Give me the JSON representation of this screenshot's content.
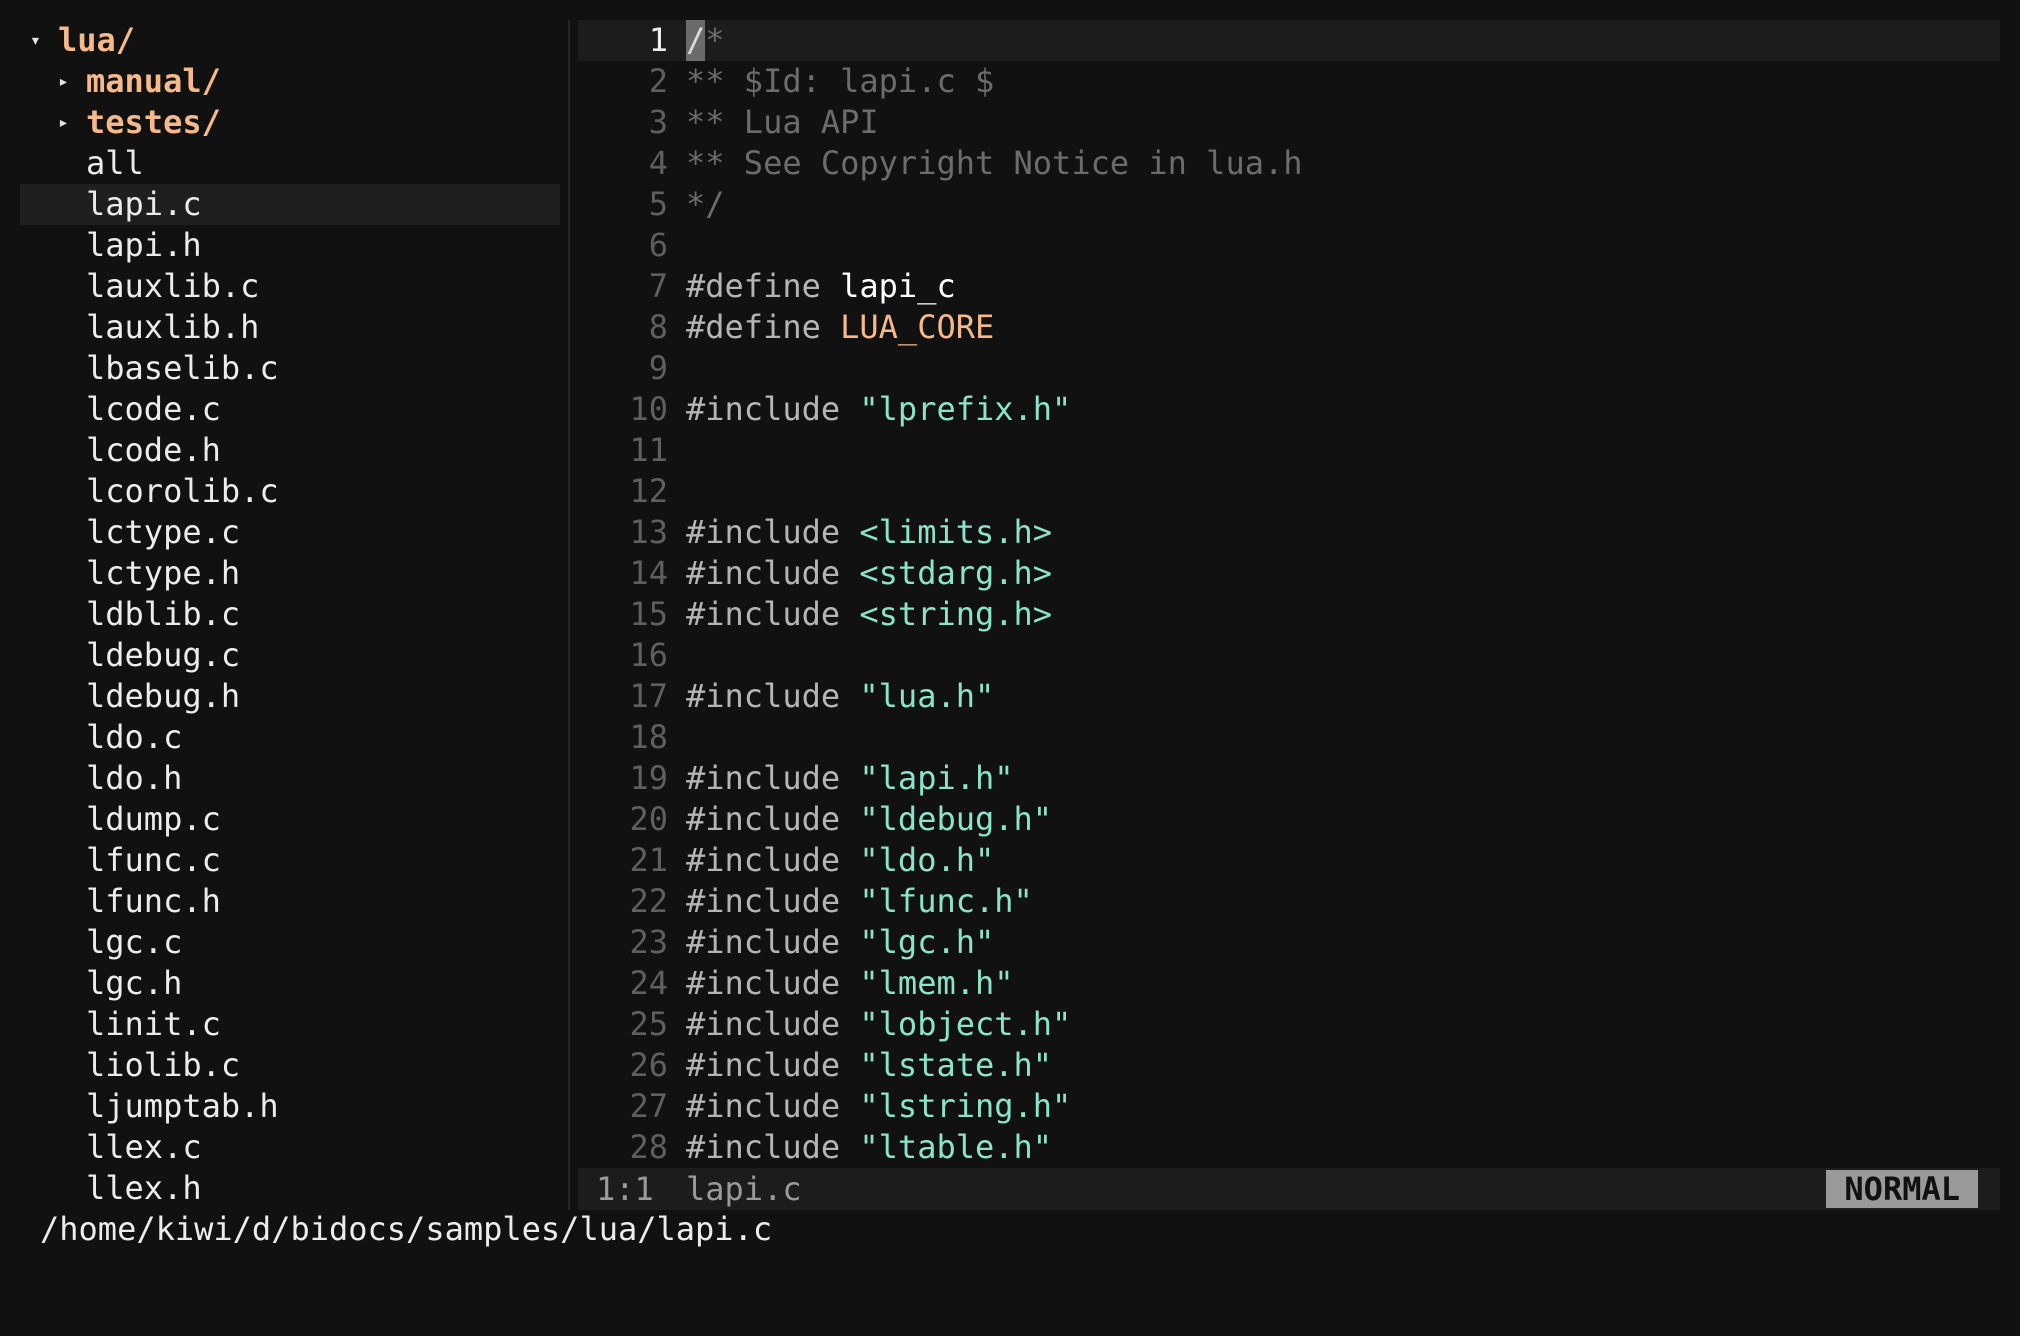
{
  "file_tree": [
    {
      "type": "dir",
      "name": "lua/",
      "expanded": true,
      "depth": 0
    },
    {
      "type": "dir",
      "name": "manual/",
      "expanded": false,
      "depth": 1
    },
    {
      "type": "dir",
      "name": "testes/",
      "expanded": false,
      "depth": 1
    },
    {
      "type": "file",
      "name": "all",
      "depth": 1
    },
    {
      "type": "file",
      "name": "lapi.c",
      "depth": 1,
      "selected": true
    },
    {
      "type": "file",
      "name": "lapi.h",
      "depth": 1
    },
    {
      "type": "file",
      "name": "lauxlib.c",
      "depth": 1
    },
    {
      "type": "file",
      "name": "lauxlib.h",
      "depth": 1
    },
    {
      "type": "file",
      "name": "lbaselib.c",
      "depth": 1
    },
    {
      "type": "file",
      "name": "lcode.c",
      "depth": 1
    },
    {
      "type": "file",
      "name": "lcode.h",
      "depth": 1
    },
    {
      "type": "file",
      "name": "lcorolib.c",
      "depth": 1
    },
    {
      "type": "file",
      "name": "lctype.c",
      "depth": 1
    },
    {
      "type": "file",
      "name": "lctype.h",
      "depth": 1
    },
    {
      "type": "file",
      "name": "ldblib.c",
      "depth": 1
    },
    {
      "type": "file",
      "name": "ldebug.c",
      "depth": 1
    },
    {
      "type": "file",
      "name": "ldebug.h",
      "depth": 1
    },
    {
      "type": "file",
      "name": "ldo.c",
      "depth": 1
    },
    {
      "type": "file",
      "name": "ldo.h",
      "depth": 1
    },
    {
      "type": "file",
      "name": "ldump.c",
      "depth": 1
    },
    {
      "type": "file",
      "name": "lfunc.c",
      "depth": 1
    },
    {
      "type": "file",
      "name": "lfunc.h",
      "depth": 1
    },
    {
      "type": "file",
      "name": "lgc.c",
      "depth": 1
    },
    {
      "type": "file",
      "name": "lgc.h",
      "depth": 1
    },
    {
      "type": "file",
      "name": "linit.c",
      "depth": 1
    },
    {
      "type": "file",
      "name": "liolib.c",
      "depth": 1
    },
    {
      "type": "file",
      "name": "ljumptab.h",
      "depth": 1
    },
    {
      "type": "file",
      "name": "llex.c",
      "depth": 1
    },
    {
      "type": "file",
      "name": "llex.h",
      "depth": 1
    }
  ],
  "editor": {
    "current_line": 1,
    "lines": [
      {
        "n": 1,
        "tokens": [
          {
            "t": "cursor",
            "v": "/"
          },
          {
            "t": "comment",
            "v": "*"
          }
        ]
      },
      {
        "n": 2,
        "tokens": [
          {
            "t": "comment",
            "v": "** $Id: lapi.c $"
          }
        ]
      },
      {
        "n": 3,
        "tokens": [
          {
            "t": "comment",
            "v": "** Lua API"
          }
        ]
      },
      {
        "n": 4,
        "tokens": [
          {
            "t": "comment",
            "v": "** See Copyright Notice in lua.h"
          }
        ]
      },
      {
        "n": 5,
        "tokens": [
          {
            "t": "comment",
            "v": "*/"
          }
        ]
      },
      {
        "n": 6,
        "tokens": []
      },
      {
        "n": 7,
        "tokens": [
          {
            "t": "kw",
            "v": "#define "
          },
          {
            "t": "id",
            "v": "lapi_c"
          }
        ]
      },
      {
        "n": 8,
        "tokens": [
          {
            "t": "kw",
            "v": "#define "
          },
          {
            "t": "const",
            "v": "LUA_CORE"
          }
        ]
      },
      {
        "n": 9,
        "tokens": []
      },
      {
        "n": 10,
        "tokens": [
          {
            "t": "kw",
            "v": "#include "
          },
          {
            "t": "str",
            "v": "\"lprefix.h\""
          }
        ]
      },
      {
        "n": 11,
        "tokens": []
      },
      {
        "n": 12,
        "tokens": []
      },
      {
        "n": 13,
        "tokens": [
          {
            "t": "kw",
            "v": "#include "
          },
          {
            "t": "str",
            "v": "<limits.h>"
          }
        ]
      },
      {
        "n": 14,
        "tokens": [
          {
            "t": "kw",
            "v": "#include "
          },
          {
            "t": "str",
            "v": "<stdarg.h>"
          }
        ]
      },
      {
        "n": 15,
        "tokens": [
          {
            "t": "kw",
            "v": "#include "
          },
          {
            "t": "str",
            "v": "<string.h>"
          }
        ]
      },
      {
        "n": 16,
        "tokens": []
      },
      {
        "n": 17,
        "tokens": [
          {
            "t": "kw",
            "v": "#include "
          },
          {
            "t": "str",
            "v": "\"lua.h\""
          }
        ]
      },
      {
        "n": 18,
        "tokens": []
      },
      {
        "n": 19,
        "tokens": [
          {
            "t": "kw",
            "v": "#include "
          },
          {
            "t": "str",
            "v": "\"lapi.h\""
          }
        ]
      },
      {
        "n": 20,
        "tokens": [
          {
            "t": "kw",
            "v": "#include "
          },
          {
            "t": "str",
            "v": "\"ldebug.h\""
          }
        ]
      },
      {
        "n": 21,
        "tokens": [
          {
            "t": "kw",
            "v": "#include "
          },
          {
            "t": "str",
            "v": "\"ldo.h\""
          }
        ]
      },
      {
        "n": 22,
        "tokens": [
          {
            "t": "kw",
            "v": "#include "
          },
          {
            "t": "str",
            "v": "\"lfunc.h\""
          }
        ]
      },
      {
        "n": 23,
        "tokens": [
          {
            "t": "kw",
            "v": "#include "
          },
          {
            "t": "str",
            "v": "\"lgc.h\""
          }
        ]
      },
      {
        "n": 24,
        "tokens": [
          {
            "t": "kw",
            "v": "#include "
          },
          {
            "t": "str",
            "v": "\"lmem.h\""
          }
        ]
      },
      {
        "n": 25,
        "tokens": [
          {
            "t": "kw",
            "v": "#include "
          },
          {
            "t": "str",
            "v": "\"lobject.h\""
          }
        ]
      },
      {
        "n": 26,
        "tokens": [
          {
            "t": "kw",
            "v": "#include "
          },
          {
            "t": "str",
            "v": "\"lstate.h\""
          }
        ]
      },
      {
        "n": 27,
        "tokens": [
          {
            "t": "kw",
            "v": "#include "
          },
          {
            "t": "str",
            "v": "\"lstring.h\""
          }
        ]
      },
      {
        "n": 28,
        "tokens": [
          {
            "t": "kw",
            "v": "#include "
          },
          {
            "t": "str",
            "v": "\"ltable.h\""
          }
        ]
      }
    ]
  },
  "statusbar": {
    "position": "1:1",
    "filename": "lapi.c",
    "mode": "NORMAL"
  },
  "command_line": {
    "path": "/home/kiwi/d/bidocs/samples/lua/lapi.c"
  },
  "icons": {
    "expanded": "triangle-down",
    "collapsed": "triangle-right"
  },
  "colors": {
    "background": "#111111",
    "directory": "#f5b98a",
    "string": "#8be3c9",
    "comment": "#6c6c6c",
    "mode_badge": "#9a9a9a"
  }
}
